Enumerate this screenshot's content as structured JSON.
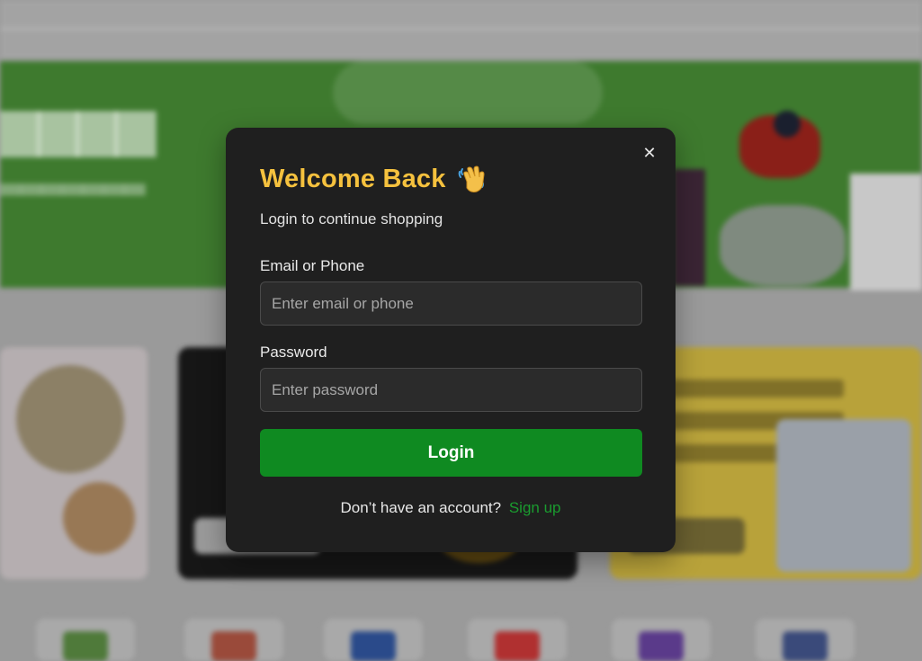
{
  "modal": {
    "title": "Welcome Back",
    "title_icon": "waving-hand-icon",
    "subtitle": "Login to continue shopping",
    "close_icon": "close-icon",
    "email_label": "Email or Phone",
    "email_placeholder": "Enter email or phone",
    "email_value": "",
    "password_label": "Password",
    "password_placeholder": "Enter password",
    "password_value": "",
    "login_button": "Login",
    "signup_prompt": "Don’t have an account?",
    "signup_link": "Sign up"
  },
  "colors": {
    "modal_bg": "#1f1f1f",
    "title": "#f5c13e",
    "primary_button": "#0f8a21",
    "link": "#1a9c2f",
    "overlay": "#9a9a9a"
  }
}
